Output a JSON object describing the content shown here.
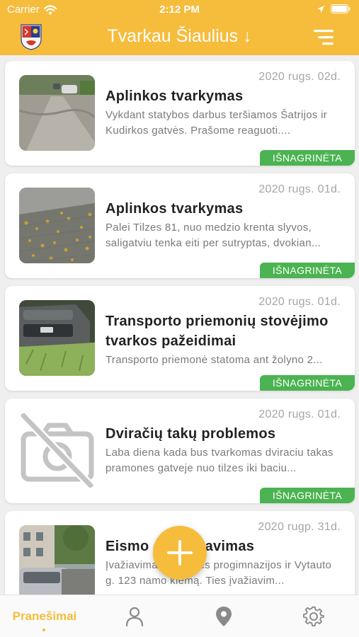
{
  "status_bar": {
    "carrier": "Carrier",
    "time": "2:12 PM"
  },
  "header": {
    "title": "Tvarkau Šiaulius ↓"
  },
  "reports": [
    {
      "date": "2020 rugs. 02d.",
      "title": "Aplinkos tvarkymas",
      "description": "Vykdant statybos darbus teršiamos Šatrijos ir Kudirkos gatvės. Prašome reaguoti....",
      "status": "IŠNAGRINĖTA"
    },
    {
      "date": "2020 rugs. 01d.",
      "title": "Aplinkos tvarkymas",
      "description": "Palei Tilzes 81, nuo medzio krenta slyvos, saligatviu tenka eiti per sutryptas, dvokian...",
      "status": "IŠNAGRINĖTA"
    },
    {
      "date": "2020 rugs. 01d.",
      "title": "Transporto priemonių stovėjimo tvarkos pažeidimai",
      "description": "Transporto priemonė statoma ant žolyno 2...",
      "status": "IŠNAGRINĖTA"
    },
    {
      "date": "2020 rugs. 01d.",
      "title": "Dviračių takų problemos",
      "description": "Laba diena kada bus tvarkomas dviraciu takas pramones gatveje nuo tilzes iki baciu...",
      "status": "IŠNAGRINĖTA"
    },
    {
      "date": "2020 rugp. 31d.",
      "title": "Eismo organizavimas",
      "description": "Įvažiavimas iš gatvės progimnazijos ir Vytauto g. 123 namo kiemą. Ties įvažiavim...",
      "status": ""
    }
  ],
  "tabs": [
    {
      "label": "Pranešimai",
      "icon": "list-icon",
      "active": true
    },
    {
      "label": "",
      "icon": "person-icon"
    },
    {
      "label": "",
      "icon": "map-pin-icon"
    },
    {
      "label": "",
      "icon": "gear-icon"
    }
  ],
  "colors": {
    "accent": "#f6bc3c",
    "status_green": "#4bb351"
  }
}
